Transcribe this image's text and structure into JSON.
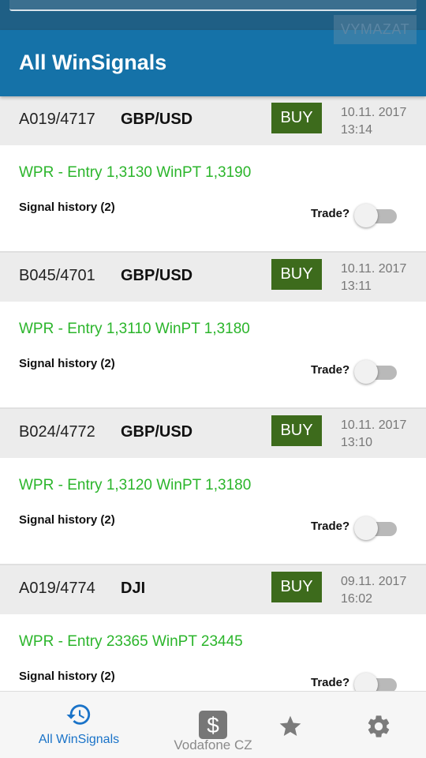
{
  "header": {
    "clear_label": "VYMAZAT",
    "title": "All WinSignals"
  },
  "signals": [
    {
      "id": "A019/4717",
      "pair": "GBP/USD",
      "action": "BUY",
      "date": "10.11. 2017",
      "time": "13:14",
      "details": "WPR - Entry 1,3130 WinPT 1,3190",
      "history": "Signal history (2)",
      "trade_label": "Trade?",
      "trade_on": false
    },
    {
      "id": "B045/4701",
      "pair": "GBP/USD",
      "action": "BUY",
      "date": "10.11. 2017",
      "time": "13:11",
      "details": "WPR - Entry 1,3110 WinPT 1,3180",
      "history": "Signal history (2)",
      "trade_label": "Trade?",
      "trade_on": false
    },
    {
      "id": "B024/4772",
      "pair": "GBP/USD",
      "action": "BUY",
      "date": "10.11. 2017",
      "time": "13:10",
      "details": "WPR - Entry 1,3120 WinPT 1,3180",
      "history": "Signal history (2)",
      "trade_label": "Trade?",
      "trade_on": false
    },
    {
      "id": "A019/4774",
      "pair": "DJI",
      "action": "BUY",
      "date": "09.11. 2017",
      "time": "16:02",
      "details": "WPR - Entry 23365 WinPT 23445",
      "history": "Signal history (2)",
      "trade_label": "Trade?",
      "trade_on": false
    }
  ],
  "bottom_nav": {
    "items": [
      {
        "label": "All WinSignals",
        "icon": "history-icon",
        "active": true
      },
      {
        "label": "Vodafone CZ",
        "icon": "dollar-icon",
        "active": false
      },
      {
        "label": "",
        "icon": "star-icon",
        "active": false
      },
      {
        "label": "",
        "icon": "gear-icon",
        "active": false
      }
    ]
  },
  "colors": {
    "app_bar": "#1572a8",
    "buy_button": "#3d6b1c",
    "entry_text": "#2bb52b",
    "nav_active": "#1a73c8"
  }
}
